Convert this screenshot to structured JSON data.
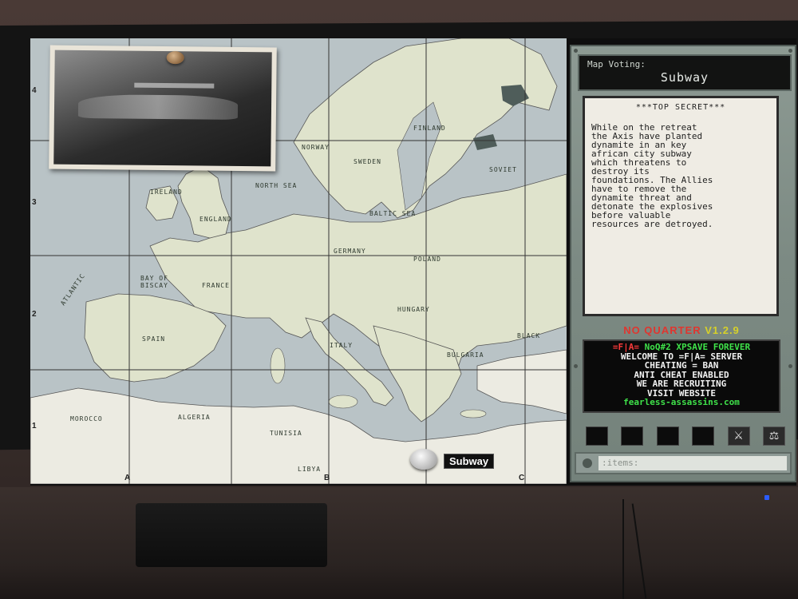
{
  "map_voting": {
    "title": "Map Voting:",
    "selected_map": "Subway"
  },
  "briefing": {
    "header": "***TOP SECRET***",
    "text": "While on the retreat\nthe Axis have planted\ndynamite in an key\nafrican city subway\nwhich threatens to\ndestroy its\nfoundations. The Allies\nhave to remove the\ndynamite threat and\ndetonate the explosives\nbefore valuable\nresources are detroyed."
  },
  "motd": {
    "mod_name": "NO QUARTER",
    "mod_version": "V1.2.9",
    "lines": [
      {
        "text_red": "=F|A=",
        "text_green": "NoQ#2 XPSAVE FOREVER"
      },
      {
        "text": "WELCOME TO =F|A= SERVER"
      },
      {
        "text": "CHEATING = BAN"
      },
      {
        "text": "ANTI CHEAT ENABLED"
      },
      {
        "text": "WE ARE RECRUITING"
      },
      {
        "text": "VISIT WEBSITE"
      },
      {
        "text_green": "fearless-assassins.com"
      }
    ]
  },
  "items": {
    "placeholder": ":items:"
  },
  "map": {
    "marker_label": "Subway",
    "grid_rows": [
      "4",
      "3",
      "2",
      "1"
    ],
    "grid_cols": [
      "A",
      "B",
      "C"
    ],
    "labels": {
      "finland": "FINLAND",
      "norway": "NORWAY",
      "sweden": "SWEDEN",
      "soviet": "SOVIET",
      "ireland": "IRELAND",
      "england": "ENGLAND",
      "north_sea": "NORTH SEA",
      "baltic_sea": "BALTIC SEA",
      "atlantic": "ATLANTIC",
      "bay_of_biscay": "BAY OF BISCAY",
      "france": "FRANCE",
      "germany": "GERMANY",
      "poland": "POLAND",
      "hungary": "HUNGARY",
      "bulgaria": "BULGARIA",
      "black_sea": "BLACK",
      "morocco": "MOROCCO",
      "algeria": "ALGERIA",
      "tunisia": "TUNISIA",
      "libya": "LIBYA",
      "spain": "SPAIN",
      "italy": "ITALY"
    }
  },
  "colors": {
    "mod_name": "#e0362f",
    "mod_version": "#d6d02a",
    "motd_white": "#f2f2f2",
    "motd_green": "#3fe24a",
    "motd_red": "#ff3a3a",
    "land": "#dfe3cc",
    "water": "#b9c3c6",
    "panel": "#84918a"
  }
}
